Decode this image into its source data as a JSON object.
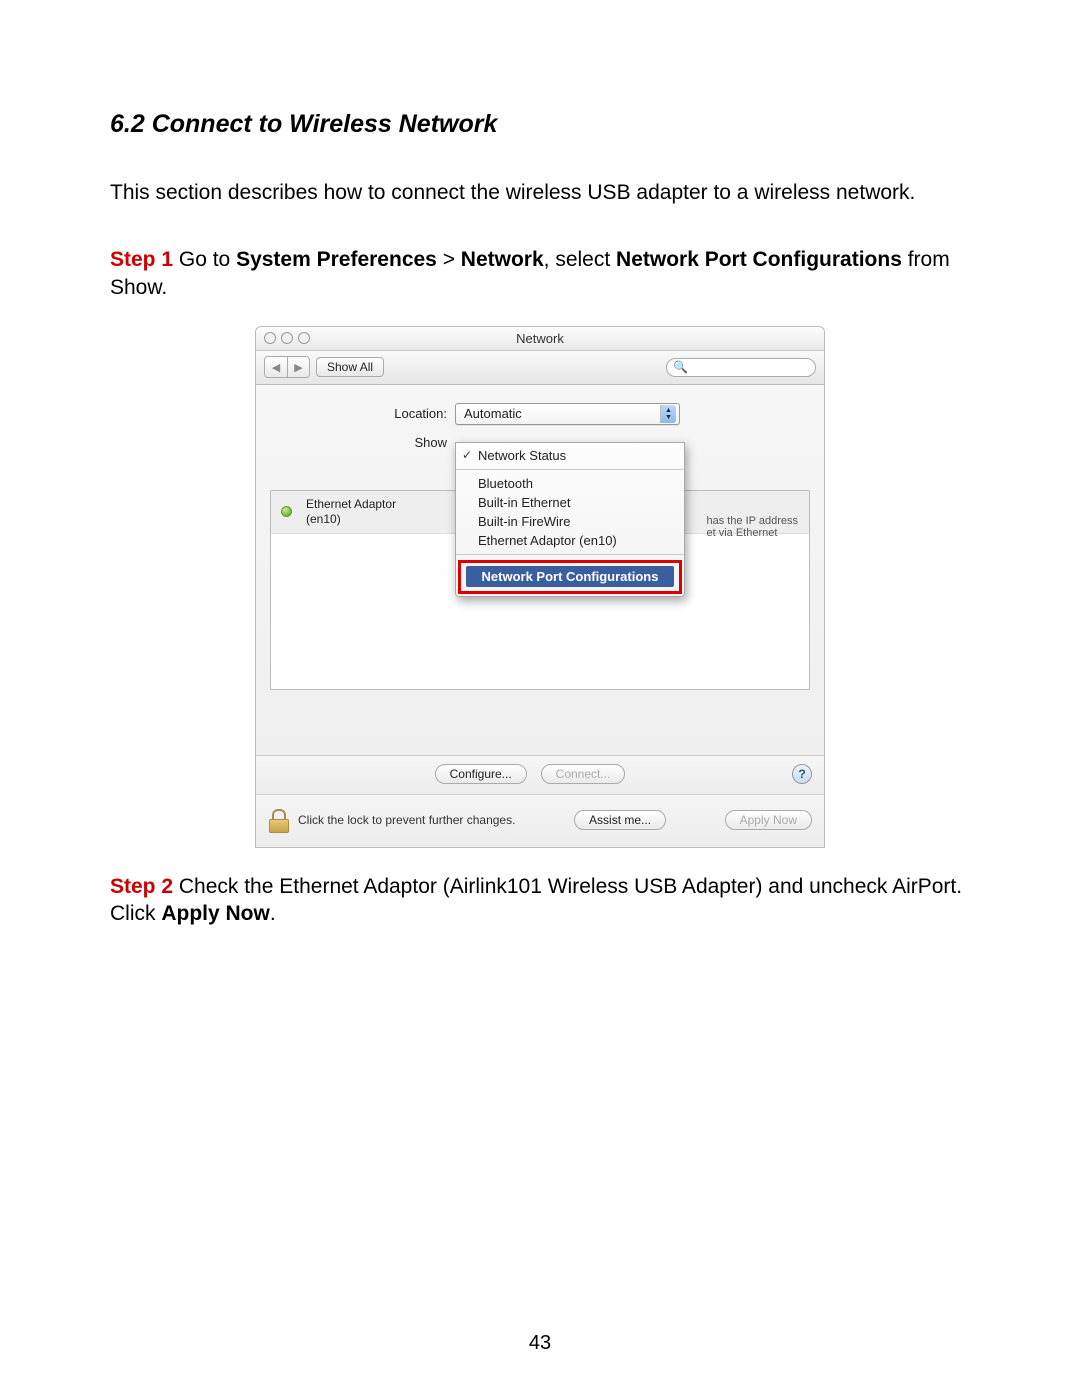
{
  "doc": {
    "heading": "6.2 Connect to Wireless Network",
    "intro": "This section describes how to connect the wireless USB adapter to a wireless network.",
    "step1": {
      "label": "Step 1",
      "t1": " Go to ",
      "b1": "System Preferences",
      "t2": " > ",
      "b2": "Network",
      "t3": ", select ",
      "b3": "Network Port Configurations",
      "t4": " from Show."
    },
    "step2": {
      "label": "Step 2",
      "t1": " Check the Ethernet Adaptor (Airlink101 Wireless USB Adapter) and uncheck AirPort. Click ",
      "b1": "Apply Now",
      "t2": "."
    },
    "page_number": "43"
  },
  "win": {
    "title": "Network",
    "toolbar": {
      "show_all": "Show All",
      "search_placeholder": ""
    },
    "labels": {
      "location": "Location:",
      "show": "Show"
    },
    "location_value": "Automatic",
    "show_menu": {
      "selected": "Network Status",
      "items": [
        "Bluetooth",
        "Built-in Ethernet",
        "Built-in FireWire",
        "Ethernet Adaptor (en10)"
      ],
      "highlight": "Network Port Configurations"
    },
    "sidebar": {
      "adapter_name": "Ethernet Adaptor",
      "adapter_sub": "(en10)"
    },
    "side_hint_line1": "has the IP address",
    "side_hint_line2": "et via Ethernet",
    "buttons": {
      "configure": "Configure...",
      "connect": "Connect...",
      "assist": "Assist me...",
      "apply": "Apply Now"
    },
    "lock_text": "Click the lock to prevent further changes."
  }
}
